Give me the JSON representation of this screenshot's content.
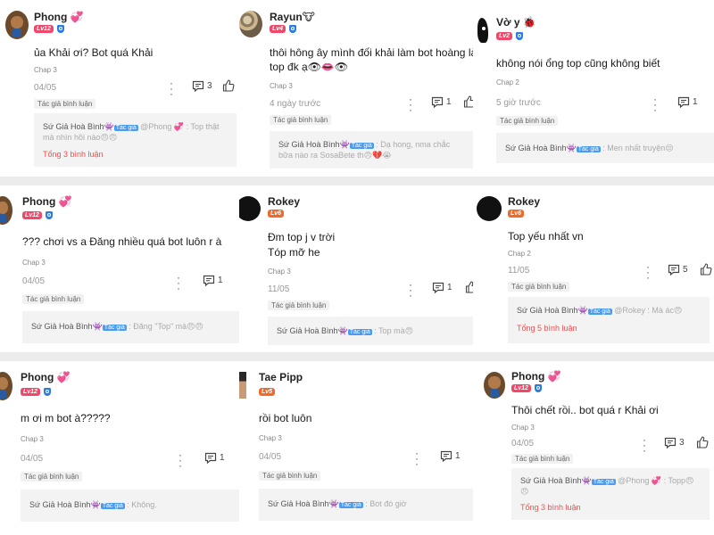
{
  "labels": {
    "author_liked": "Tác giả bình luận",
    "author_tag": "Tác giả",
    "sender": "Sứ Giả Hoà Bình👾"
  },
  "comments": [
    {
      "username": "Phong 💞",
      "level": "Lv12",
      "avatar": "dog-avatar",
      "text": [
        "ủa Khải ơi? Bot quá Khải"
      ],
      "chapter": "Chap 3",
      "date": "04/05",
      "comment_count": "3",
      "reply": {
        "line1_rest": " @Phong 💞 : Top thật",
        "line2": "mà nhìn hồi nào😠😠"
      },
      "total": "Tổng 3 bình luận"
    },
    {
      "username": "Rayun🐮",
      "level": "Lv4",
      "avatar": "rice-avatar",
      "text": [
        "thôi hông ây mình đối khải làm bot hoàng làm",
        "top đk ạ👁👄👁"
      ],
      "chapter": "Chap 3",
      "date": "4 ngày trước",
      "comment_count": "1",
      "reply": {
        "line1_rest": " : Dạ hong, nma chắc",
        "line2": "bữa nào ra SosaBete th😠💔😭"
      },
      "total": ""
    },
    {
      "username": "Vờ y 🐞",
      "level": "Lv2",
      "avatar": "cameraman-avatar",
      "text": [
        "không nói ổng top cũng không biết"
      ],
      "chapter": "Chap 2",
      "date": "5 giờ trước",
      "comment_count": "1",
      "reply": {
        "line1_rest": " : Men nhất truyện😒",
        "line2": ""
      },
      "total": ""
    },
    {
      "username": "Phong 💞",
      "level": "Lv12",
      "avatar": "dog-avatar",
      "text": [
        "??? chơi vs a Đăng nhiều quá bot luôn r à"
      ],
      "chapter": "Chap 3",
      "date": "04/05",
      "comment_count": "1",
      "reply": {
        "line1_rest": " : Đăng \"Top\" mà😠😠",
        "line2": ""
      },
      "total": ""
    },
    {
      "username": "Rokey",
      "level": "Lv6",
      "avatar": "black-avatar",
      "text": [
        "Đm top j v trời",
        "Tóp mỡ he"
      ],
      "chapter": "Chap 3",
      "date": "11/05",
      "comment_count": "1",
      "reply": {
        "line1_rest": " : Top mà😠",
        "line2": ""
      },
      "total": ""
    },
    {
      "username": "Rokey",
      "level": "Lv6",
      "avatar": "black-avatar",
      "text": [
        "Top yếu nhất vn"
      ],
      "chapter": "Chap 2",
      "date": "11/05",
      "comment_count": "5",
      "reply": {
        "line1_rest": " @Rokey : Mà ác😠",
        "line2": ""
      },
      "total": "Tổng 5 bình luận"
    },
    {
      "username": "Phong 💞",
      "level": "Lv12",
      "avatar": "dog-avatar",
      "text": [
        "m ơi m bot à?????"
      ],
      "chapter": "Chap 3",
      "date": "04/05",
      "comment_count": "1",
      "reply": {
        "line1_rest": " : Không.",
        "line2": ""
      },
      "total": ""
    },
    {
      "username": "Tae Pipp",
      "level": "Lv5",
      "avatar": "face-avatar",
      "text": [
        "rồi bot luôn"
      ],
      "chapter": "Chap 3",
      "date": "04/05",
      "comment_count": "1",
      "reply": {
        "line1_rest": " : Bot đó giờ",
        "line2": ""
      },
      "total": ""
    },
    {
      "username": "Phong 💞",
      "level": "Lv12",
      "avatar": "dog-avatar",
      "text": [
        "Thôi chết rồi.. bot quá r Khải ơi"
      ],
      "chapter": "Chap 3",
      "date": "04/05",
      "comment_count": "3",
      "reply": {
        "line1_rest": " @Phong 💞 : Topp😠",
        "line2": "😠"
      },
      "total": "Tổng 3 bình luận"
    }
  ]
}
